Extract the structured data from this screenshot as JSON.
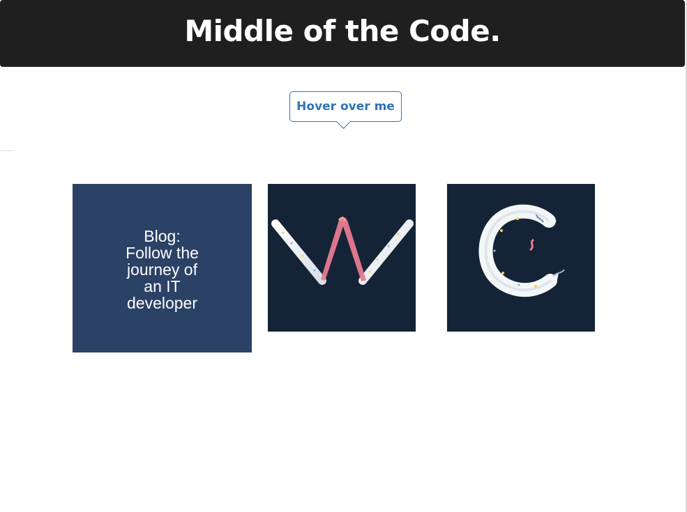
{
  "header": {
    "title": "Middle of the Code."
  },
  "hover": {
    "label": "Hover over me"
  },
  "cards": {
    "blog": {
      "text": "Blog:\nFollow the\njourney of\nan IT\ndeveloper"
    }
  },
  "colors": {
    "header_bg": "#1f1f1f",
    "header_text": "#ffffff",
    "button_accent": "#2f74b5",
    "blog_card_bg": "#2b4166",
    "letter_card_bg": "#142436",
    "w_ribbon": "#e77b93",
    "c_balloon": "#f4f7f8"
  },
  "icons": {
    "w_tile": "letter-w-balloon-icon",
    "c_tile": "letter-c-balloon-icon"
  }
}
